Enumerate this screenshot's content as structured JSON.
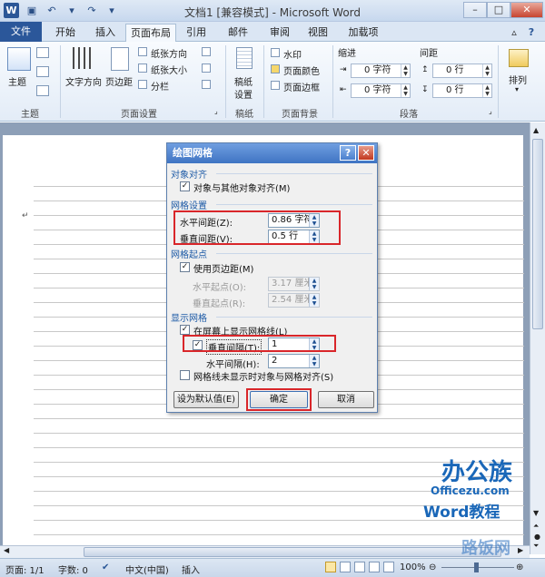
{
  "app": {
    "title": "文档1 [兼容模式] - Microsoft Word"
  },
  "tabs": [
    {
      "label": "文件"
    },
    {
      "label": "开始"
    },
    {
      "label": "插入"
    },
    {
      "label": "页面布局"
    },
    {
      "label": "引用"
    },
    {
      "label": "邮件"
    },
    {
      "label": "审阅"
    },
    {
      "label": "视图"
    },
    {
      "label": "加载项"
    }
  ],
  "ribbon": {
    "theme": {
      "btn": "主题",
      "group": "主题"
    },
    "page_setup": {
      "text_direction": "文字方向",
      "margins": "页边距",
      "orientation": "纸张方向",
      "size": "纸张大小",
      "columns": "分栏",
      "group": "页面设置"
    },
    "draft": {
      "btn1": "稿纸",
      "btn2": "设置",
      "group": "稿纸"
    },
    "background": {
      "watermark": "水印",
      "color": "页面颜色",
      "border": "页面边框",
      "group": "页面背景"
    },
    "paragraph": {
      "indent": "缩进",
      "spacing": "间距",
      "indent_left": "0 字符",
      "indent_right": "0 字符",
      "spacing_before": "0 行",
      "spacing_after": "0 行",
      "group": "段落"
    },
    "arrange": {
      "btn": "排列"
    }
  },
  "dialog": {
    "title": "绘图网格",
    "sec_align": "对象对齐",
    "align_objects": "对象与其他对象对齐(M)",
    "sec_grid": "网格设置",
    "h_spacing_label": "水平间距(Z):",
    "h_spacing_value": "0.86 字符",
    "v_spacing_label": "垂直间距(V):",
    "v_spacing_value": "0.5 行",
    "sec_origin": "网格起点",
    "use_margins": "使用页边距(M)",
    "h_origin_label": "水平起点(O):",
    "h_origin_value": "3.17 厘米",
    "v_origin_label": "垂直起点(R):",
    "v_origin_value": "2.54 厘米",
    "sec_display": "显示网格",
    "show_lines": "在屏幕上显示网格线(L)",
    "v_interval_label": "垂直间隔(T):",
    "v_interval_value": "1",
    "h_interval_label": "水平间隔(H):",
    "h_interval_value": "2",
    "snap_hidden": "网格线未显示时对象与网格对齐(S)",
    "default_btn": "设为默认值(E)",
    "ok_btn": "确定",
    "cancel_btn": "取消"
  },
  "status": {
    "page": "页面: 1/1",
    "words": "字数: 0",
    "language": "中文(中国)",
    "mode": "插入",
    "zoom": "100%"
  },
  "watermark": {
    "brand": "办公族",
    "site": "Officezu.com",
    "subtitle": "Word教程",
    "corner": "路饭网"
  }
}
